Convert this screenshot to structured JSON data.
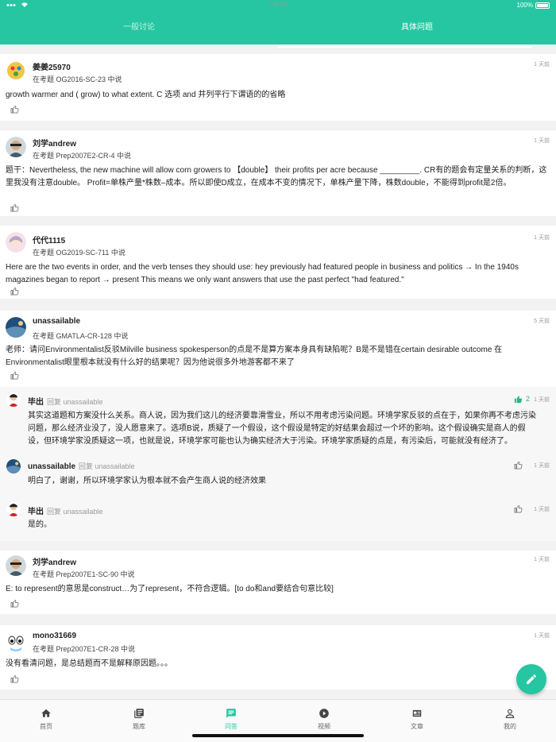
{
  "status": {
    "time": "7:35 AM",
    "battery": "100%"
  },
  "tabs": [
    {
      "label": "一般讨论"
    },
    {
      "label": "具体问题"
    }
  ],
  "posts": [
    {
      "user": "姜姜25970",
      "meta": "在考题 OG2016-SC-23 中说",
      "time": "1 天前",
      "body": "growth warmer and ( grow) to what extent. C 选项 and 并列平行下谓语的的省略"
    },
    {
      "user": "刘学andrew",
      "meta": "在考题 Prep2007E2-CR-4 中说",
      "time": "1 天前",
      "body": "题干：Nevertheless, the new machine will allow corn growers to 【double】 their profits per acre because _________. CR有的题会有定量关系的判断，这里我没有注意double。 Profit=单株产量*株数–成本。所以即使D成立，在成本不变的情况下，单株产量下降，株数double，不能得到profit是2倍。"
    },
    {
      "user": "代代1115",
      "meta": "在考题 OG2019-SC-711 中说",
      "time": "1 天前",
      "body": "Here are the two events in order, and the verb tenses they should use: hey previously had featured people in business and politics → In the 1940s magazines began to report → present This means we only want answers that use the past perfect \"had featured.\""
    },
    {
      "user": "unassailable",
      "meta": "在考题 GMATLA-CR-128 中说",
      "time": "5 天前",
      "body": "老师：请问Environmentalist反驳Milville business spokesperson的点是不是算方案本身具有缺陷呢？B是不是错在certain desirable outcome 在Environmentalist眼里根本就没有什么好的结果呢？因为他说很多外地游客都不来了"
    },
    {
      "user": "刘学andrew",
      "meta": "在考题 Prep2007E1-SC-90 中说",
      "time": "1 天前",
      "body": "E: to represent的意思是construct…为了represent，不符合逻辑。[to do和and要结合句意比较]"
    },
    {
      "user": "mono31669",
      "meta": "在考题 Prep2007E1-CR-28 中说",
      "time": "1 天前",
      "body": "没有看清问题，是总结题而不是解释原因题。。。"
    }
  ],
  "replies": [
    {
      "user": "毕出",
      "to": "回复 unassailable",
      "time": "1 天前",
      "likes": "2",
      "body": "其实这道题和方案没什么关系。商人说，因为我们这儿的经济要靠滑雪业，所以不用考虑污染问题。环境学家反驳的点在于，如果你再不考虑污染问题，那么经济业没了，没人愿意来了。选项B说，质疑了一个假设，这个假设是特定的好结果会超过一个坏的影响。这个假设确实是商人的假设，但环境学家没质疑这一项，也就是说，环境学家可能也认为确实经济大于污染。环境学家质疑的点是，有污染后，可能就没有经济了。"
    },
    {
      "user": "unassailable",
      "to": "回复 unassailable",
      "time": "1 天前",
      "likes": "",
      "body": "明白了，谢谢，所以环境学家认为根本就不会产生商人说的经济效果"
    },
    {
      "user": "毕出",
      "to": "回复 unassailable",
      "time": "1 天前",
      "likes": "",
      "body": "是的。"
    }
  ],
  "nav": [
    {
      "label": "首页",
      "icon": "home-icon"
    },
    {
      "label": "题库",
      "icon": "library-icon"
    },
    {
      "label": "问答",
      "icon": "chat-icon"
    },
    {
      "label": "视频",
      "icon": "play-icon"
    },
    {
      "label": "文章",
      "icon": "article-icon"
    },
    {
      "label": "我的",
      "icon": "person-icon"
    }
  ],
  "colors": {
    "accent": "#26c6a2",
    "like_active": "#2bb48d"
  }
}
